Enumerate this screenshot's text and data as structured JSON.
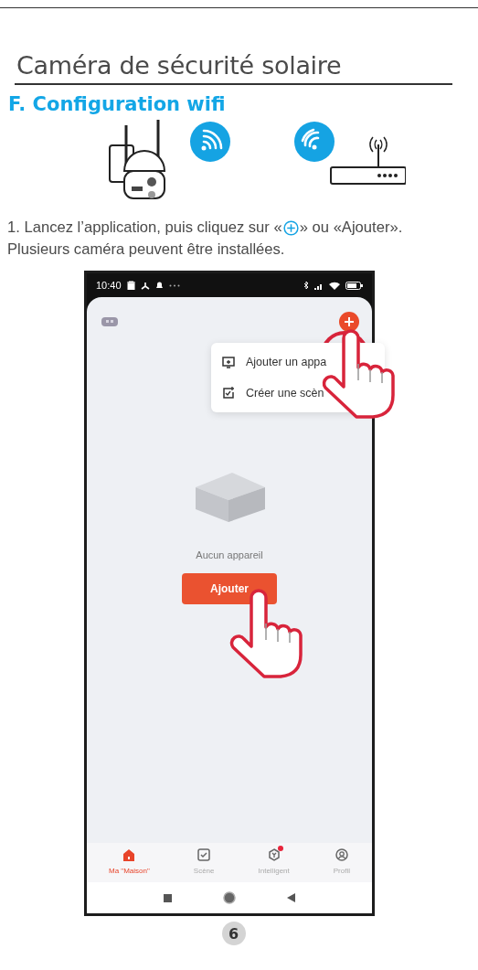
{
  "document": {
    "title": "Caméra de sécurité solaire",
    "section": "F. Configuration wifi",
    "step_before_icon": "1. Lancez l’application, puis cliquez sur «",
    "step_after_icon": "» ou «Ajouter».",
    "step_line_2": "Plusieurs caméra peuvent être installées.",
    "page_number": "6"
  },
  "phone": {
    "time": "10:40",
    "menu": [
      {
        "label": "Ajouter un appa"
      },
      {
        "label": "Créer une scèn"
      }
    ],
    "empty_text": "Aucun appareil",
    "add_button": "Ajouter",
    "tabs": [
      {
        "label": "Ma \"Maison\"",
        "selected": true,
        "badge": false
      },
      {
        "label": "Scène",
        "selected": false,
        "badge": false
      },
      {
        "label": "Intelligent",
        "selected": false,
        "badge": true
      },
      {
        "label": "Profil",
        "selected": false,
        "badge": false
      }
    ]
  }
}
